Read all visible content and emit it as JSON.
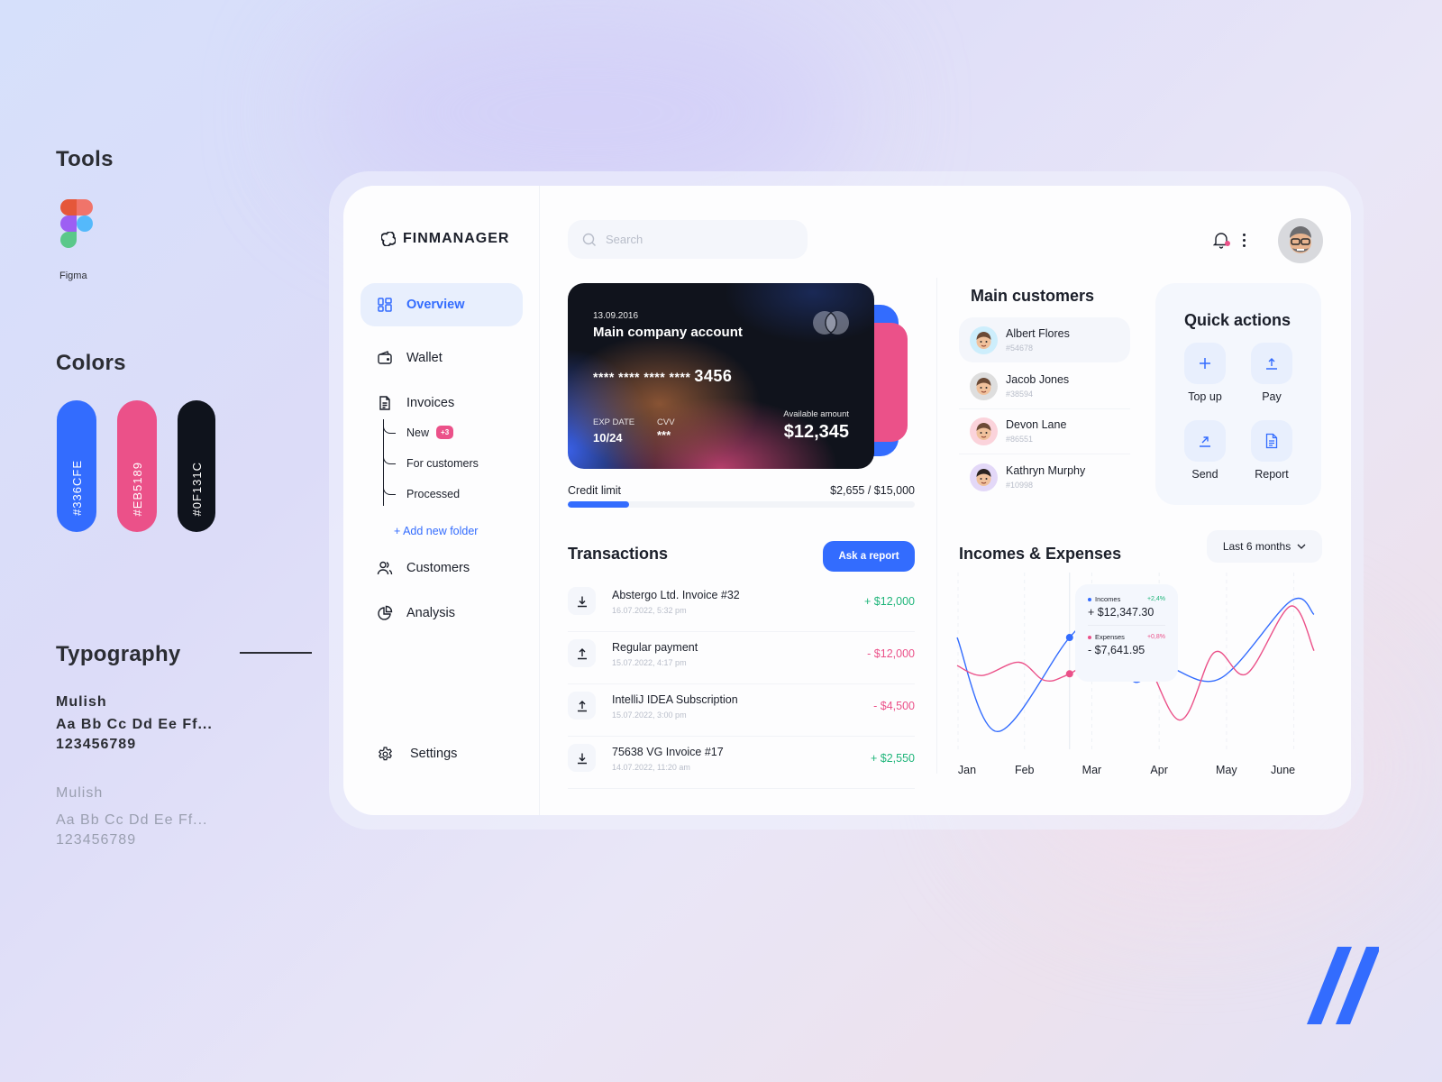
{
  "guide": {
    "tools_title": "Tools",
    "tool_name": "Figma",
    "colors_title": "Colors",
    "colors": [
      {
        "label": "#336CFE",
        "hex": "#336cfe"
      },
      {
        "label": "#EB5189",
        "hex": "#eb5189"
      },
      {
        "label": "#0F131C",
        "hex": "#0f131c"
      }
    ],
    "typography_title": "Typography",
    "font_samples": [
      {
        "name": "Mulish",
        "sample": "Aa Bb Cc Dd Ee Ff...",
        "digits": "123456789"
      },
      {
        "name": "Mulish",
        "sample": "Aa Bb Cc Dd Ee Ff...",
        "digits": "123456789"
      }
    ]
  },
  "app": {
    "brand": "FINMANAGER",
    "sidebar": {
      "items": [
        {
          "label": "Overview",
          "icon": "grid-icon",
          "active": true
        },
        {
          "label": "Wallet",
          "icon": "wallet-icon"
        },
        {
          "label": "Invoices",
          "icon": "document-icon"
        },
        {
          "label": "Customers",
          "icon": "users-icon"
        },
        {
          "label": "Analysis",
          "icon": "pie-chart-icon"
        }
      ],
      "invoice_subitems": [
        {
          "label": "New",
          "badge": "+3"
        },
        {
          "label": "For customers"
        },
        {
          "label": "Processed"
        }
      ],
      "add_folder": "+ Add new folder",
      "settings": "Settings"
    },
    "search": {
      "placeholder": "Search",
      "value": ""
    },
    "card": {
      "date": "13.09.2016",
      "name": "Main company account",
      "number_mask": "**** **** **** ****",
      "number_last": "3456",
      "exp_label": "EXP DATE",
      "exp_value": "10/24",
      "cvv_label": "CVV",
      "cvv_value": "***",
      "available_label": "Available amount",
      "available_value": "$12,345"
    },
    "credit": {
      "label": "Credit limit",
      "value": "$2,655 / $15,000",
      "used_fraction": 0.177
    },
    "transactions": {
      "title": "Transactions",
      "button": "Ask a report",
      "rows": [
        {
          "name": "Abstergo Ltd. Invoice #32",
          "date": "16.07.2022, 5:32 pm",
          "amount": "+ $12,000",
          "direction": "in"
        },
        {
          "name": "Regular payment",
          "date": "15.07.2022, 4:17 pm",
          "amount": "- $12,000",
          "direction": "out"
        },
        {
          "name": "IntelliJ IDEA Subscription",
          "date": "15.07.2022, 3:00 pm",
          "amount": "- $4,500",
          "direction": "out"
        },
        {
          "name": "75638 VG Invoice #17",
          "date": "14.07.2022, 11:20 am",
          "amount": "+ $2,550",
          "direction": "in"
        }
      ]
    },
    "customers": {
      "title": "Main customers",
      "rows": [
        {
          "name": "Albert Flores",
          "id": "#54678",
          "avatar_bg": "#cdeefc",
          "active": true
        },
        {
          "name": "Jacob Jones",
          "id": "#38594",
          "avatar_bg": "#dedede"
        },
        {
          "name": "Devon Lane",
          "id": "#86551",
          "avatar_bg": "#fbd3db"
        },
        {
          "name": "Kathryn Murphy",
          "id": "#10998",
          "avatar_bg": "#e3d8f8"
        }
      ]
    },
    "quick_actions": {
      "title": "Quick actions",
      "items": [
        {
          "label": "Top up",
          "icon": "plus-icon"
        },
        {
          "label": "Pay",
          "icon": "upload-icon"
        },
        {
          "label": "Send",
          "icon": "send-arrow-icon"
        },
        {
          "label": "Report",
          "icon": "report-document-icon"
        }
      ]
    },
    "chart_section": {
      "title": "Incomes & Expenses",
      "range": "Last 6 months",
      "tooltip": {
        "incomes_label": "Incomes",
        "incomes_change": "+2,4%",
        "incomes_value": "+ $12,347.30",
        "expenses_label": "Expenses",
        "expenses_change": "+0,8%",
        "expenses_value": "- $7,641.95"
      }
    }
  },
  "chart_data": {
    "type": "line",
    "title": "Incomes & Expenses",
    "categories": [
      "Jan",
      "Feb",
      "Mar",
      "Apr",
      "May",
      "June"
    ],
    "x_range": [
      0,
      5.3
    ],
    "y_range": [
      0,
      100
    ],
    "y_units": "relative (no axis shown)",
    "grid": "vertical dashed at each month",
    "highlight_x": 1.67,
    "series": [
      {
        "name": "Incomes",
        "color": "#336cfe",
        "x": [
          0,
          0.6,
          1.67,
          2.2,
          2.6,
          3.05,
          3.9,
          4.95,
          5.3
        ],
        "values": [
          65,
          8,
          65,
          80,
          39,
          48,
          40,
          87,
          79
        ]
      },
      {
        "name": "Expenses",
        "color": "#eb5189",
        "x": [
          0,
          0.37,
          0.92,
          1.3,
          1.67,
          2.6,
          3.3,
          3.82,
          4.3,
          4.95,
          5.3
        ],
        "values": [
          48,
          42,
          50,
          39,
          43,
          62,
          15,
          56,
          43,
          84,
          57
        ]
      }
    ]
  }
}
